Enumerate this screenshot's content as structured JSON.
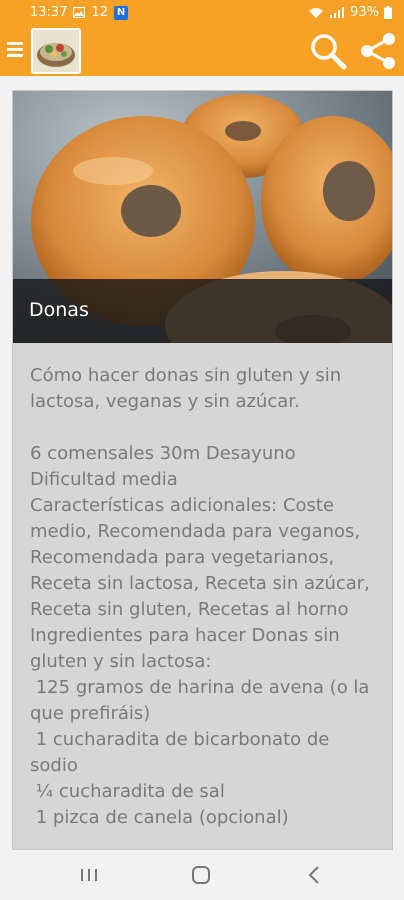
{
  "status_bar": {
    "time": "13:37",
    "notif_count": "12",
    "n_badge": "N",
    "battery": "93%"
  },
  "app_bar": {
    "menu_icon": "hamburger-menu-icon",
    "logo": "app-logo",
    "search_icon": "search-icon",
    "share_icon": "share-icon",
    "accent_color": "#f7a127"
  },
  "recipe": {
    "title": "Donas",
    "body": "Cómo hacer donas sin gluten y sin lactosa, veganas y sin azúcar.\n\n6 comensales 30m Desayuno Dificultad media\nCaracterísticas adicionales: Coste medio, Recomendada para veganos, Recomendada para vegetarianos, Receta sin lactosa, Receta sin azúcar, Receta sin gluten, Recetas al horno\nIngredientes para hacer Donas sin gluten y sin lactosa:\n 125 gramos de harina de avena (o la que prefiráis)\n 1 cucharadita de bicarbonato de sodio\n ¼ cucharadita de sal\n 1 pizca de canela (opcional)"
  },
  "nav_bar": {
    "recents_icon": "recents-icon",
    "home_icon": "home-icon",
    "back_icon": "back-icon"
  }
}
